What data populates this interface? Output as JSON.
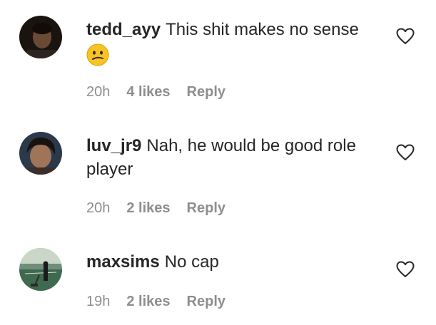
{
  "comments": [
    {
      "username": "tedd_ayy",
      "text": "This shit makes no sense",
      "emoji": "🫤",
      "time": "20h",
      "likes": "4 likes",
      "reply": "Reply",
      "avatar_icon": "profile-photo"
    },
    {
      "username": "luv_jr9",
      "text": "Nah, he would be good role player",
      "time": "20h",
      "likes": "2 likes",
      "reply": "Reply",
      "avatar_icon": "profile-photo"
    },
    {
      "username": "maxsims",
      "text": "No cap",
      "time": "19h",
      "likes": "2 likes",
      "reply": "Reply",
      "avatar_icon": "profile-photo"
    }
  ],
  "colors": {
    "text": "#262626",
    "meta": "#8e8e8e",
    "heart_stroke": "#262626",
    "emoji_face": "#f7c325"
  },
  "icons": {
    "like": "heart-outline-icon",
    "reaction": "confused-face-emoji"
  }
}
